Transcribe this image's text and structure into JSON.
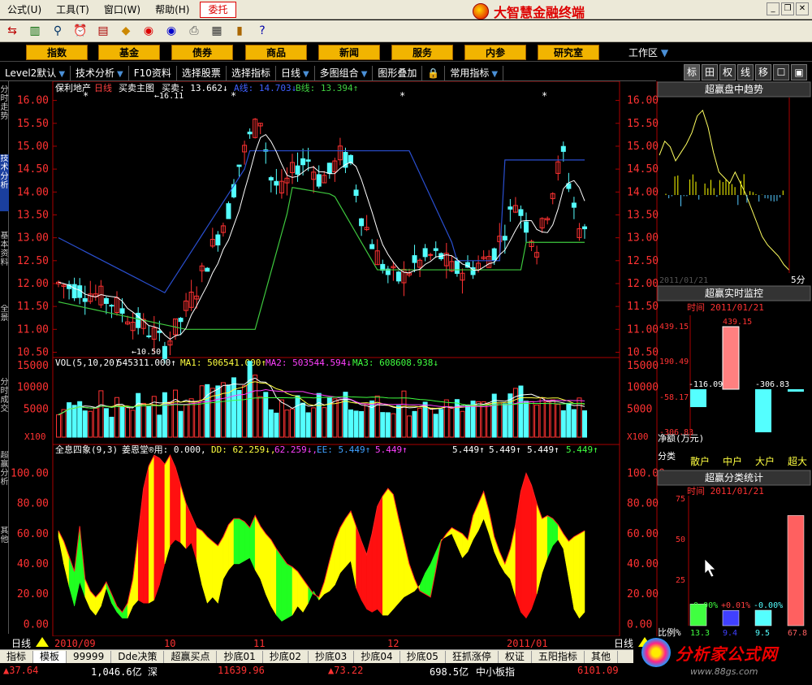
{
  "menubar": {
    "items": [
      "公式(U)",
      "工具(T)",
      "窗口(W)",
      "帮助(H)"
    ],
    "highlight": "委托",
    "app_title": "大智慧金融终端"
  },
  "categories": [
    "指数",
    "基金",
    "债券",
    "商品",
    "新闻",
    "服务",
    "内参",
    "研究室"
  ],
  "workspace_label": "工作区",
  "subbar": [
    "Level2默认",
    "技术分析",
    "F10资料",
    "选择股票",
    "选择指标",
    "日线",
    "多图组合",
    "图形叠加",
    "常用指标"
  ],
  "righttabs": [
    "标",
    "田",
    "权",
    "线",
    "移",
    "☐",
    "▣"
  ],
  "lefttabs": [
    "分时走势",
    "技术分析",
    "基本资料",
    "全景",
    "分时成交",
    "超赢分析",
    "其他"
  ],
  "main_chart": {
    "name": "保利地产",
    "period": "日线",
    "indicator": "买卖主图",
    "buy_sell_label": "买卖: 13.662↓",
    "a_line_label": "A线: 14.703↓",
    "b_line_label": "B线: 13.394↑",
    "high_mark": "16.11",
    "low_mark": "10.50",
    "y_ticks": [
      "16.00",
      "15.50",
      "15.00",
      "14.50",
      "14.00",
      "13.50",
      "13.00",
      "12.50",
      "12.00",
      "11.50",
      "11.00",
      "10.50"
    ],
    "y_values": [
      16.0,
      15.5,
      15.0,
      14.5,
      14.0,
      13.5,
      13.0,
      12.5,
      12.0,
      11.5,
      11.0,
      10.5
    ]
  },
  "volume_chart": {
    "label": "VOL(5,10,20)",
    "vol_value": "545311.000↑",
    "ma1": "MA1: 506541.000↑",
    "ma2": "MA2: 503544.594↓",
    "ma3": "MA3: 608608.938↓",
    "unit": "X100",
    "y_ticks": [
      "15000",
      "10000",
      "5000"
    ],
    "y_values": [
      15000,
      10000,
      5000
    ]
  },
  "indicator_chart": {
    "label": "全息四象(9,3)",
    "patent": "姜恩堂®用: 0.000,",
    "dd": "DD: 62.259↓,",
    "dd2": "62.259↓,",
    "ee": "EE: 5.449↑",
    "vals": [
      "5.449↑",
      "5.449↑",
      "5.449↑",
      "5.449↑",
      "5.449↑"
    ],
    "y_ticks": [
      "100.00",
      "80.00",
      "60.00",
      "40.00",
      "20.00",
      "0.00"
    ],
    "y_values": [
      100,
      80,
      60,
      40,
      20,
      0
    ]
  },
  "x_axis": {
    "period": "日线",
    "labels": [
      "2010/09",
      "10",
      "11",
      "12",
      "2011/01"
    ]
  },
  "right_panels": {
    "trend_title": "超赢盘中趋势",
    "trend_date": "2011/01/21",
    "trend_unit": "5分",
    "monitor_title": "超赢实时监控",
    "monitor_time": "时间  2011/01/21",
    "monitor_ticks": [
      "439.15",
      "190.49",
      "-58.17",
      "-306.83"
    ],
    "monitor_bar_top": "439.15",
    "monitor_bar_neg1": "-116.09",
    "monitor_bar_neg2": "-306.83",
    "net_label": "净额(万元)",
    "class_row_label": "分类",
    "classes": [
      "散户",
      "中户",
      "大户",
      "超大"
    ],
    "stat_title": "超赢分类统计",
    "stat_time": "时间  2011/01/21",
    "stat_ticks": [
      "75",
      "50",
      "25"
    ],
    "stat_pcts": [
      "-0.00%",
      "+0.01%",
      "-0.00%"
    ],
    "ratio_label": "比例%",
    "ratios": [
      "13.3",
      "9.4",
      "9.5",
      "67.8"
    ]
  },
  "bottom_tabs": [
    "指标",
    "模板",
    "99999",
    "Dde决策",
    "超赢买点",
    "抄底01",
    "抄底02",
    "抄底03",
    "抄底04",
    "抄底05",
    "狂抓涨停",
    "权证",
    "五阳指标",
    "其他"
  ],
  "status": {
    "a": "▲37.64",
    "b": "1,046.6亿",
    "c": "深",
    "d": "11639.96",
    "e": "▲73.22",
    "f": "698.5亿",
    "g": "中小板指",
    "h": "6101.09"
  },
  "brand": {
    "text": "分析家公式网",
    "url": "www.88gs.com"
  },
  "colors": {
    "up": "#ff3232",
    "down": "#54ffff",
    "a_line": "#2a4fd0",
    "b_line": "#3ec83e",
    "indicator_red": "#ff1010",
    "indicator_yellow": "#ffff00",
    "indicator_green": "#20ff20"
  }
}
